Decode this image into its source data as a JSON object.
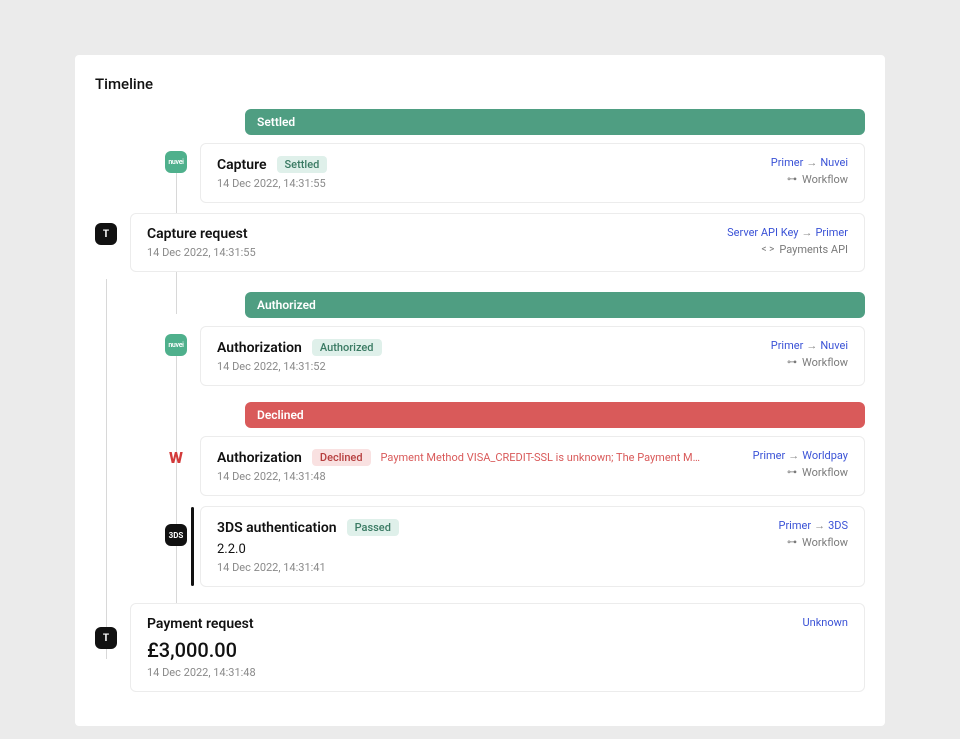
{
  "page": {
    "title": "Timeline"
  },
  "status_bars": {
    "settled": {
      "label": "Settled"
    },
    "authorized": {
      "label": "Authorized"
    },
    "declined": {
      "label": "Declined"
    }
  },
  "icons": {
    "t": "T",
    "nuvei": "nuvei",
    "worldpay": "W",
    "threeDS": "3DS"
  },
  "routes": {
    "primer_nuvei": {
      "from": "Primer",
      "to": "Nuvei"
    },
    "server_primer": {
      "from": "Server API Key",
      "to": "Primer"
    },
    "primer_worldpay": {
      "from": "Primer",
      "to": "Worldpay"
    },
    "primer_3ds": {
      "from": "Primer",
      "to": "3DS"
    }
  },
  "via": {
    "workflow": "Workflow",
    "paymentsApi": "Payments API"
  },
  "events": {
    "capture": {
      "title": "Capture",
      "badge": "Settled",
      "ts": "14 Dec 2022, 14:31:55"
    },
    "capture_request": {
      "title": "Capture request",
      "ts": "14 Dec 2022, 14:31:55"
    },
    "auth_ok": {
      "title": "Authorization",
      "badge": "Authorized",
      "ts": "14 Dec 2022, 14:31:52"
    },
    "auth_declined": {
      "title": "Authorization",
      "badge": "Declined",
      "error": "Payment Method VISA_CREDIT-SSL is unknown; The Payment Method is not …",
      "ts": "14 Dec 2022, 14:31:48"
    },
    "threeDS": {
      "title": "3DS authentication",
      "badge": "Passed",
      "version": "2.2.0",
      "ts": "14 Dec 2022, 14:31:41"
    },
    "payment_request": {
      "title": "Payment request",
      "amount": "£3,000.00",
      "ts": "14 Dec 2022, 14:31:48",
      "unknown": "Unknown"
    }
  },
  "glyphs": {
    "arrow": "→"
  }
}
